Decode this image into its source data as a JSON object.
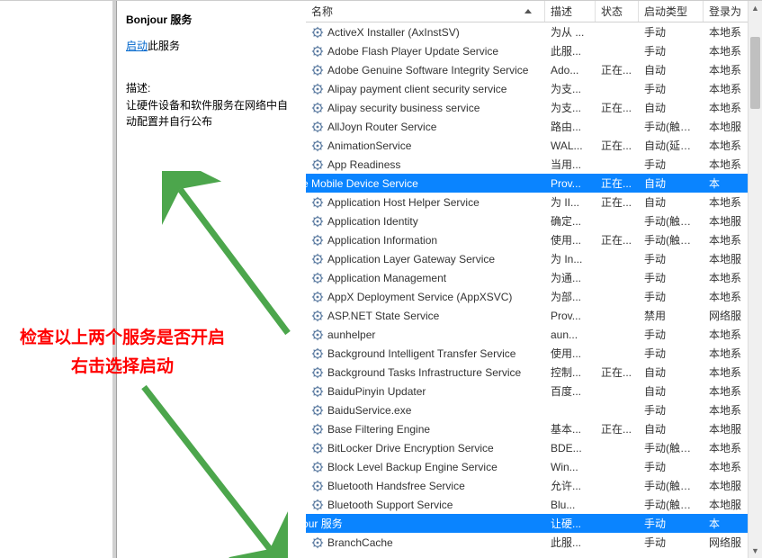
{
  "sidebar": {
    "service_title": "Bonjour 服务",
    "start_link": "启动",
    "start_suffix": "此服务",
    "desc_label": "描述:",
    "desc_text": "让硬件设备和软件服务在网络中自动配置并自行公布"
  },
  "columns": {
    "name": "名称",
    "desc": "描述",
    "status": "状态",
    "start": "启动类型",
    "logon": "登录为"
  },
  "annotation": {
    "line1": "检查以上两个服务是否开启",
    "line2": "右击选择启动"
  },
  "services": [
    {
      "name": "ActiveX Installer (AxInstSV)",
      "desc": "为从 ...",
      "status": "",
      "start": "手动",
      "logon": "本地系"
    },
    {
      "name": "Adobe Flash Player Update Service",
      "desc": "此服...",
      "status": "",
      "start": "手动",
      "logon": "本地系"
    },
    {
      "name": "Adobe Genuine Software Integrity Service",
      "desc": "Ado...",
      "status": "正在...",
      "start": "自动",
      "logon": "本地系"
    },
    {
      "name": "Alipay payment client security service",
      "desc": "为支...",
      "status": "",
      "start": "手动",
      "logon": "本地系"
    },
    {
      "name": "Alipay security business service",
      "desc": "为支...",
      "status": "正在...",
      "start": "自动",
      "logon": "本地系"
    },
    {
      "name": "AllJoyn Router Service",
      "desc": "路由...",
      "status": "",
      "start": "手动(触发...",
      "logon": "本地服"
    },
    {
      "name": "AnimationService",
      "desc": "WAL...",
      "status": "正在...",
      "start": "自动(延迟...",
      "logon": "本地系"
    },
    {
      "name": "App Readiness",
      "desc": "当用...",
      "status": "",
      "start": "手动",
      "logon": "本地系"
    },
    {
      "name": "Apple Mobile Device Service",
      "desc": "Prov...",
      "status": "正在...",
      "start": "自动",
      "logon": "本",
      "selected": true,
      "offset": true
    },
    {
      "name": "Application Host Helper Service",
      "desc": "为 II...",
      "status": "正在...",
      "start": "自动",
      "logon": "本地系"
    },
    {
      "name": "Application Identity",
      "desc": "确定...",
      "status": "",
      "start": "手动(触发...",
      "logon": "本地服"
    },
    {
      "name": "Application Information",
      "desc": "使用...",
      "status": "正在...",
      "start": "手动(触发...",
      "logon": "本地系"
    },
    {
      "name": "Application Layer Gateway Service",
      "desc": "为 In...",
      "status": "",
      "start": "手动",
      "logon": "本地服"
    },
    {
      "name": "Application Management",
      "desc": "为通...",
      "status": "",
      "start": "手动",
      "logon": "本地系"
    },
    {
      "name": "AppX Deployment Service (AppXSVC)",
      "desc": "为部...",
      "status": "",
      "start": "手动",
      "logon": "本地系"
    },
    {
      "name": "ASP.NET State Service",
      "desc": "Prov...",
      "status": "",
      "start": "禁用",
      "logon": "网络服"
    },
    {
      "name": "aunhelper",
      "desc": "aun...",
      "status": "",
      "start": "手动",
      "logon": "本地系"
    },
    {
      "name": "Background Intelligent Transfer Service",
      "desc": "使用...",
      "status": "",
      "start": "手动",
      "logon": "本地系"
    },
    {
      "name": "Background Tasks Infrastructure Service",
      "desc": "控制...",
      "status": "正在...",
      "start": "自动",
      "logon": "本地系"
    },
    {
      "name": "BaiduPinyin Updater",
      "desc": "百度...",
      "status": "",
      "start": "自动",
      "logon": "本地系"
    },
    {
      "name": "BaiduService.exe",
      "desc": "",
      "status": "",
      "start": "手动",
      "logon": "本地系"
    },
    {
      "name": "Base Filtering Engine",
      "desc": "基本...",
      "status": "正在...",
      "start": "自动",
      "logon": "本地服"
    },
    {
      "name": "BitLocker Drive Encryption Service",
      "desc": "BDE...",
      "status": "",
      "start": "手动(触发...",
      "logon": "本地系"
    },
    {
      "name": "Block Level Backup Engine Service",
      "desc": "Win...",
      "status": "",
      "start": "手动",
      "logon": "本地系"
    },
    {
      "name": "Bluetooth Handsfree Service",
      "desc": "允许...",
      "status": "",
      "start": "手动(触发...",
      "logon": "本地服"
    },
    {
      "name": "Bluetooth Support Service",
      "desc": "Blu...",
      "status": "",
      "start": "手动(触发...",
      "logon": "本地服"
    },
    {
      "name": "Bonjour 服务",
      "desc": "让硬...",
      "status": "",
      "start": "手动",
      "logon": "本",
      "selected": true,
      "offset": true
    },
    {
      "name": "BranchCache",
      "desc": "此服...",
      "status": "",
      "start": "手动",
      "logon": "网络服"
    }
  ]
}
